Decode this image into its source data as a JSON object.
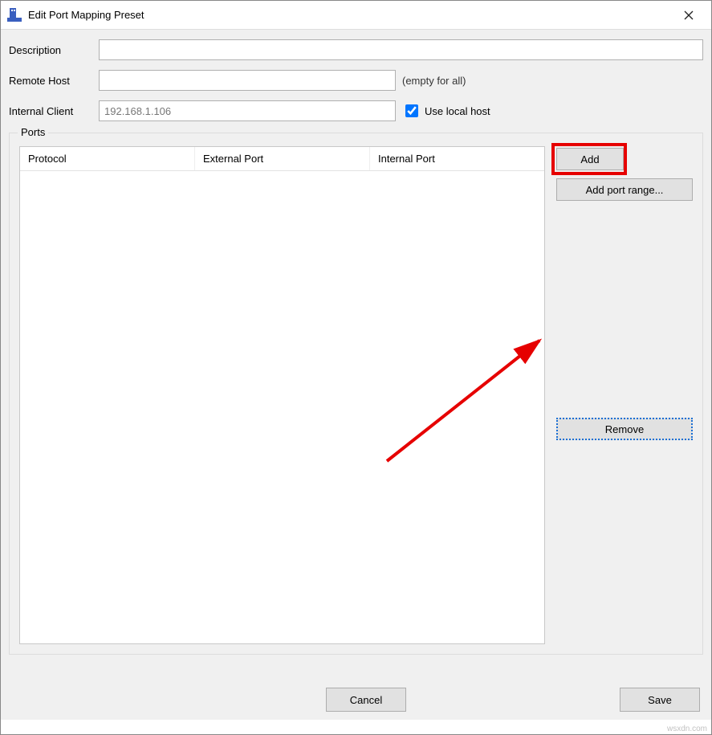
{
  "window": {
    "title": "Edit Port Mapping Preset"
  },
  "form": {
    "description_label": "Description",
    "description_value": "",
    "remote_host_label": "Remote Host",
    "remote_host_value": "",
    "remote_host_hint": "(empty for all)",
    "internal_client_label": "Internal Client",
    "internal_client_value": "192.168.1.106",
    "use_local_host_label": "Use local host",
    "use_local_host_checked": true
  },
  "ports": {
    "legend": "Ports",
    "columns": {
      "protocol": "Protocol",
      "external_port": "External Port",
      "internal_port": "Internal Port"
    },
    "rows": [],
    "buttons": {
      "add": "Add",
      "add_port_range": "Add port range...",
      "remove": "Remove"
    }
  },
  "actions": {
    "cancel": "Cancel",
    "save": "Save"
  },
  "watermark": "wsxdn.com"
}
